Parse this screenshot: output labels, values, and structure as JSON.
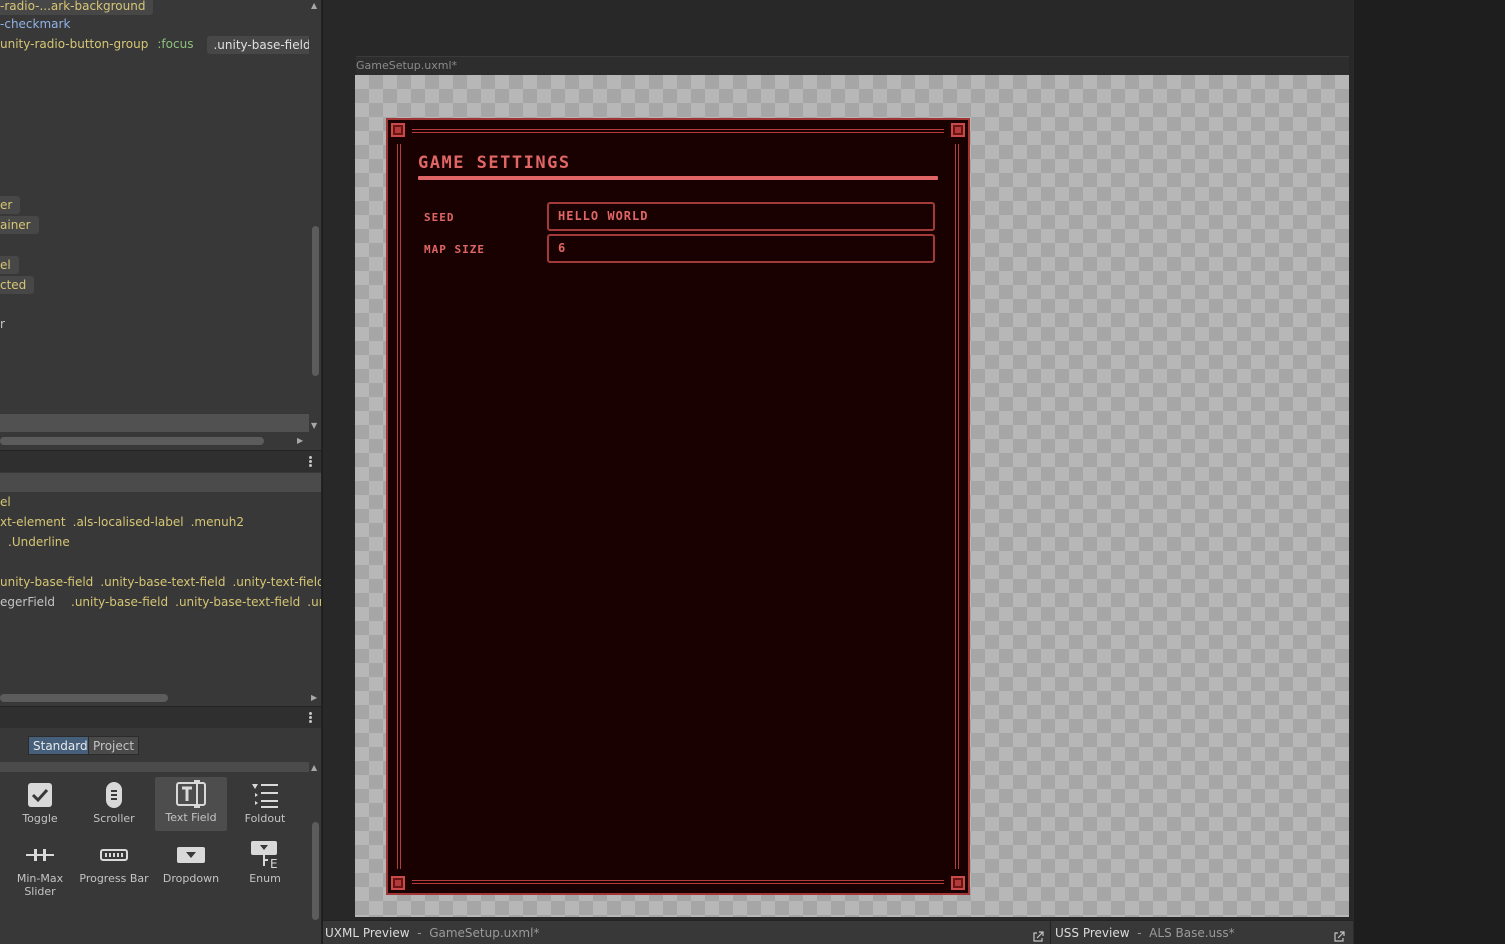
{
  "selectors": {
    "row1": "-radio-...ark-background",
    "row2": "checkmark",
    "row3": {
      "main": "unity-radio-button-group",
      "pseudo": ":focus",
      "tag": ".unity-base-field__l"
    },
    "partial": [
      "er",
      "ainer",
      "el",
      "cted",
      "r"
    ]
  },
  "classes_panel": {
    "row1": "el",
    "row2": [
      ".als-localised-label",
      ".menuh2"
    ],
    "row2_lead": "xt-element",
    "row3": ".Underline",
    "row4": [
      ".unity-base-field",
      ".unity-base-text-field",
      ".unity-text-field"
    ],
    "row4_lead": "unity-base-field",
    "row5_lead": "egerField",
    "row5": [
      ".unity-base-field",
      ".unity-base-text-field",
      ".unity"
    ]
  },
  "library": {
    "tabs": [
      "Standard",
      "Project"
    ],
    "items": [
      {
        "label": "Toggle",
        "icon": "toggle-icon"
      },
      {
        "label": "Scroller",
        "icon": "scroller-icon"
      },
      {
        "label": "Text Field",
        "icon": "text-field-icon"
      },
      {
        "label": "Foldout",
        "icon": "foldout-icon"
      },
      {
        "label": "Min-Max Slider",
        "icon": "min-max-slider-icon"
      },
      {
        "label": "Progress Bar",
        "icon": "progress-bar-icon"
      },
      {
        "label": "Dropdown",
        "icon": "dropdown-icon"
      },
      {
        "label": "Enum",
        "icon": "enum-icon"
      }
    ],
    "minmax_line1": "Min-Max",
    "minmax_line2": "Slider"
  },
  "viewport": {
    "document_title": "GameSetup.uxml*"
  },
  "game": {
    "title": "GAME SETTINGS",
    "fields": [
      {
        "label": "SEED",
        "value": "HELLO WORLD"
      },
      {
        "label": "MAP SIZE",
        "value": "6"
      }
    ]
  },
  "bottombar": {
    "uxml_title": "UXML Preview",
    "uxml_sub": "GameSetup.uxml*",
    "uss_title": "USS Preview",
    "uss_sub": "ALS Base.uss*"
  },
  "colors": {
    "accent": "#e06666",
    "panel_bg": "#1a0101",
    "border": "#a13434",
    "selector_yellow": "#d6c675",
    "pseudo_green": "#8ec07c"
  }
}
